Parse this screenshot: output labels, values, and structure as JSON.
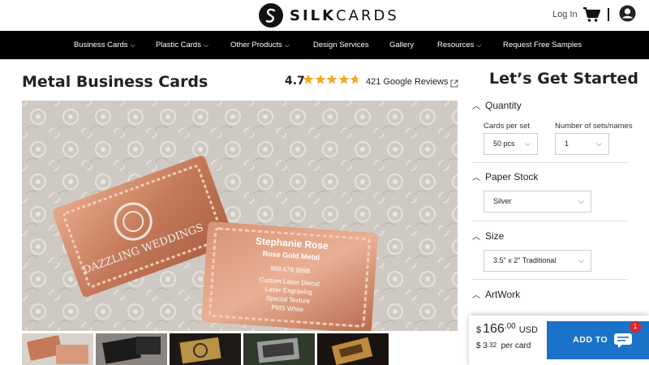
{
  "header": {
    "brand_part1": "SILK",
    "brand_part2": "CARDS",
    "login_label": "Log In"
  },
  "nav": {
    "items": [
      {
        "label": "Business Cards",
        "has_dropdown": true
      },
      {
        "label": "Plastic Cards",
        "has_dropdown": true
      },
      {
        "label": "Other Products",
        "has_dropdown": true
      },
      {
        "label": "Design Services",
        "has_dropdown": false
      },
      {
        "label": "Gallery",
        "has_dropdown": false
      },
      {
        "label": "Resources",
        "has_dropdown": true
      },
      {
        "label": "Request Free Samples",
        "has_dropdown": false
      }
    ]
  },
  "product": {
    "title": "Metal Business Cards",
    "rating_value": "4.7",
    "rating_stars": 4.7,
    "reviews_text": "421 Google Reviews"
  },
  "hero_image": {
    "card1_text": "DAZZLING WEDDINGS",
    "card2_lines": [
      "Stephanie Rose",
      "Rose Gold Metal",
      "888.678.9998",
      "Custom Laser Diecut",
      "Laser Engraving",
      "Special Texture",
      "PMS White"
    ]
  },
  "config": {
    "panel_title": "Let’s Get Started",
    "quantity": {
      "heading": "Quantity",
      "cards_per_set_label": "Cards per set",
      "cards_per_set_value": "50 pcs",
      "sets_label": "Number of sets/names",
      "sets_value": "1"
    },
    "paper_stock": {
      "heading": "Paper Stock",
      "value": "Silver"
    },
    "size": {
      "heading": "Size",
      "value": "3.5\" x 2\" Traditional"
    },
    "artwork": {
      "heading": "ArtWork"
    }
  },
  "pricing": {
    "currency_symbol": "$",
    "total_whole": "166",
    "total_cents": ".00",
    "currency_code": "USD",
    "per_card_whole": "3",
    "per_card_cents": ".32",
    "per_card_label": "per card",
    "add_to_cart_label": "ADD TO CART"
  },
  "chat": {
    "badge_count": "1"
  },
  "colors": {
    "nav_bg": "#000000",
    "accent_blue": "#1a73c8",
    "star_gold": "#f5a623",
    "badge_red": "#e0242f"
  }
}
